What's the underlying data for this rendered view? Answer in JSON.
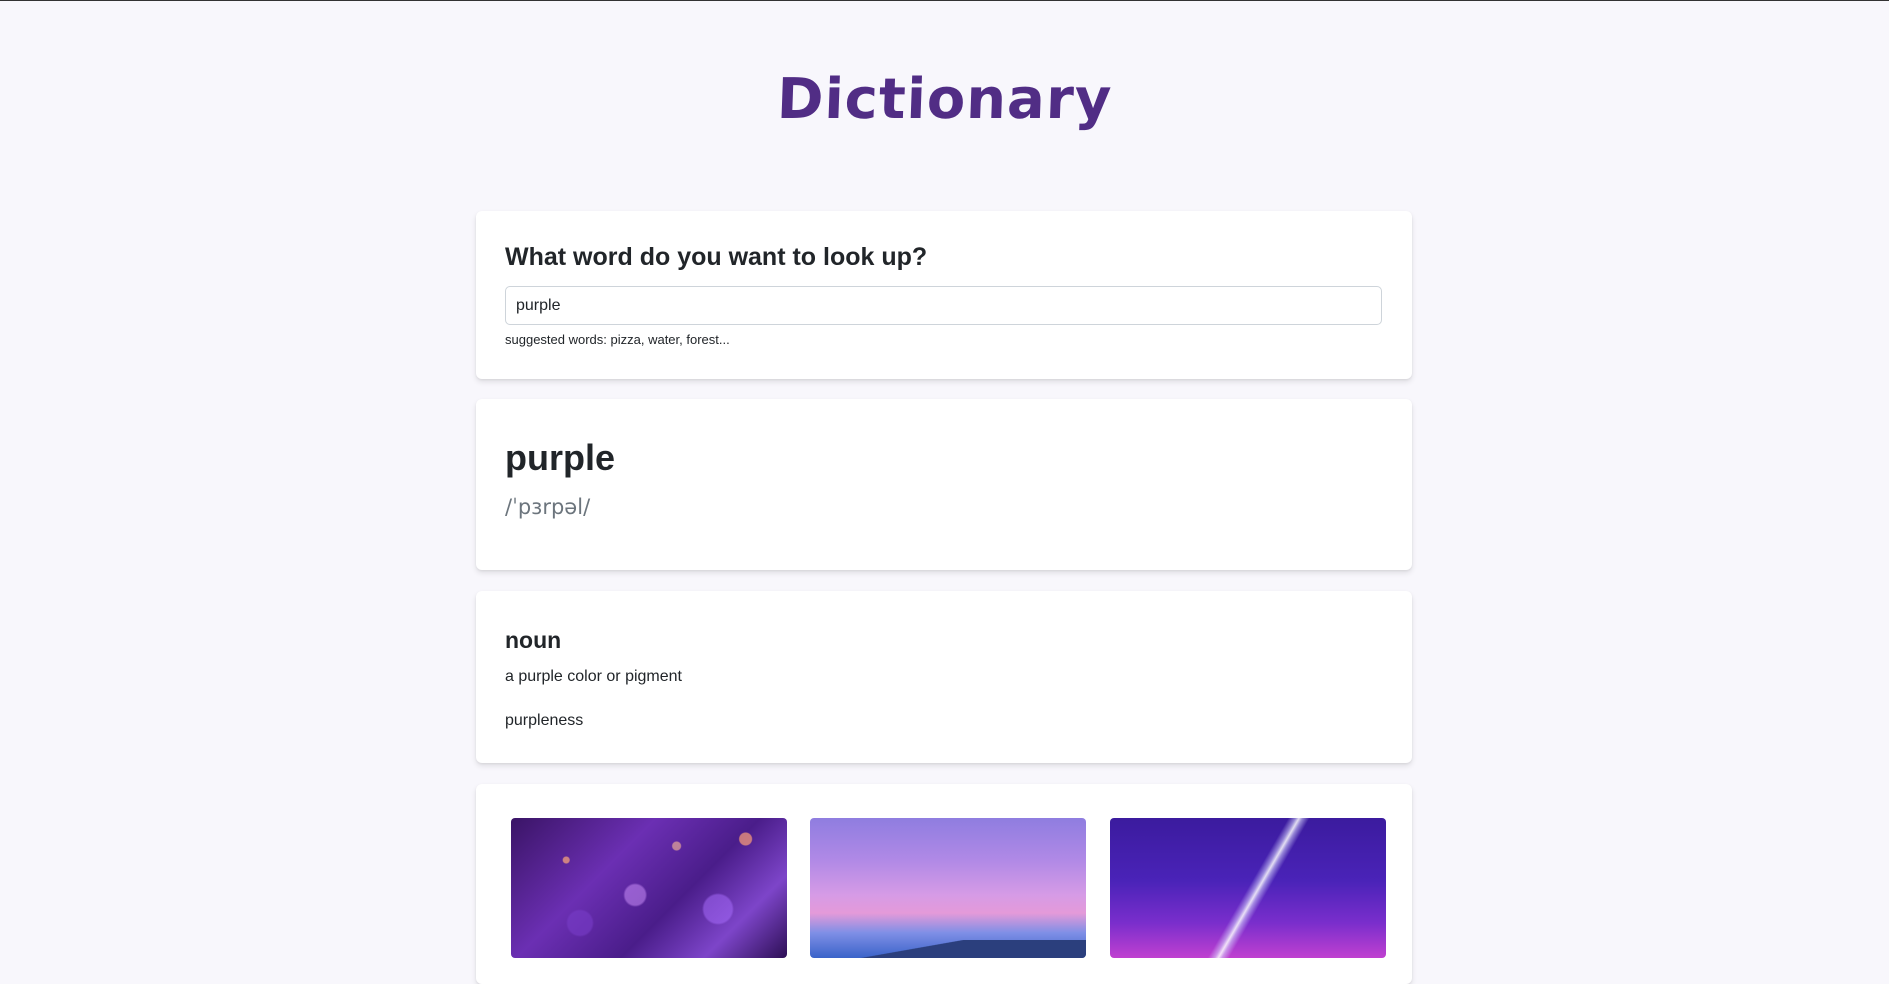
{
  "app": {
    "logo_text": "Dictionary"
  },
  "search": {
    "heading": "What word do you want to look up?",
    "input_value": "purple",
    "hint": "suggested words: pizza, water, forest..."
  },
  "result": {
    "word": "purple",
    "phonetic": "/ˈpɜrpəl/"
  },
  "meanings": [
    {
      "part_of_speech": "noun",
      "definition": "a purple color or pigment",
      "synonym": "purpleness"
    }
  ],
  "photos": [
    {
      "subject": "purple amethyst crystals"
    },
    {
      "subject": "purple pink sky over mountains"
    },
    {
      "subject": "purple starry night sky with light beam"
    }
  ],
  "colors": {
    "brand": "#512d85",
    "background": "#f8f7fc",
    "card": "#ffffff",
    "muted_text": "#6c757d"
  }
}
